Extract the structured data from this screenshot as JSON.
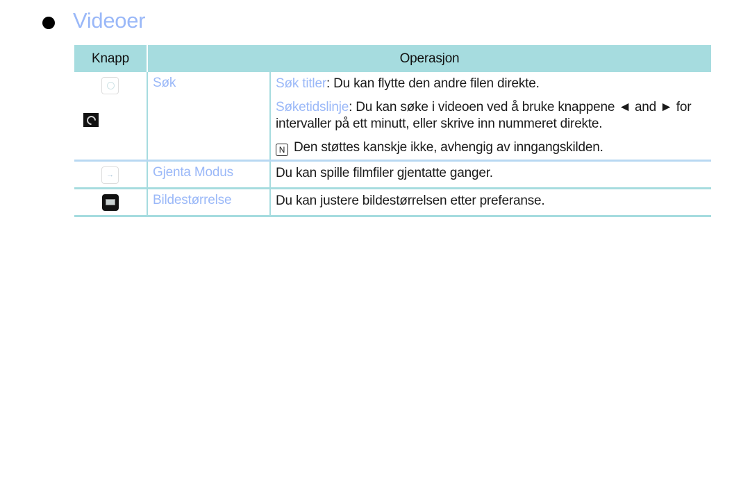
{
  "section": {
    "bullet": "●",
    "title": "Videoer"
  },
  "table": {
    "headers": [
      "Knapp",
      "Operasjon"
    ],
    "rows": [
      {
        "icons": [
          "search-icon",
          "timeline-icon"
        ],
        "name": "Søk",
        "items": [
          {
            "term": "Søk titler",
            "text": ": Du kan flytte den andre filen direkte."
          },
          {
            "term": "Søketidslinje",
            "text": ": Du kan søke i videoen ved å bruke knappene ◄ and ► for intervaller på ett minutt, eller skrive inn nummeret direkte."
          }
        ],
        "note": {
          "icon": "note-icon",
          "glyph": "N",
          "text": "Den støttes kanskje ikke, avhengig av inngangskilden."
        }
      },
      {
        "icons": [
          "repeat-icon"
        ],
        "icon_glyph": "→",
        "name": "Gjenta Modus",
        "text": "Du kan spille filmfiler gjentatte ganger."
      },
      {
        "icons": [
          "picture-size-icon"
        ],
        "name": "Bildestørrelse",
        "text": "Du kan justere bildestørrelsen etter preferanse."
      }
    ]
  },
  "colors": {
    "accent": "#9ab8f8",
    "header_bg": "#a6dcdf",
    "rule": "#a6dcdf"
  }
}
